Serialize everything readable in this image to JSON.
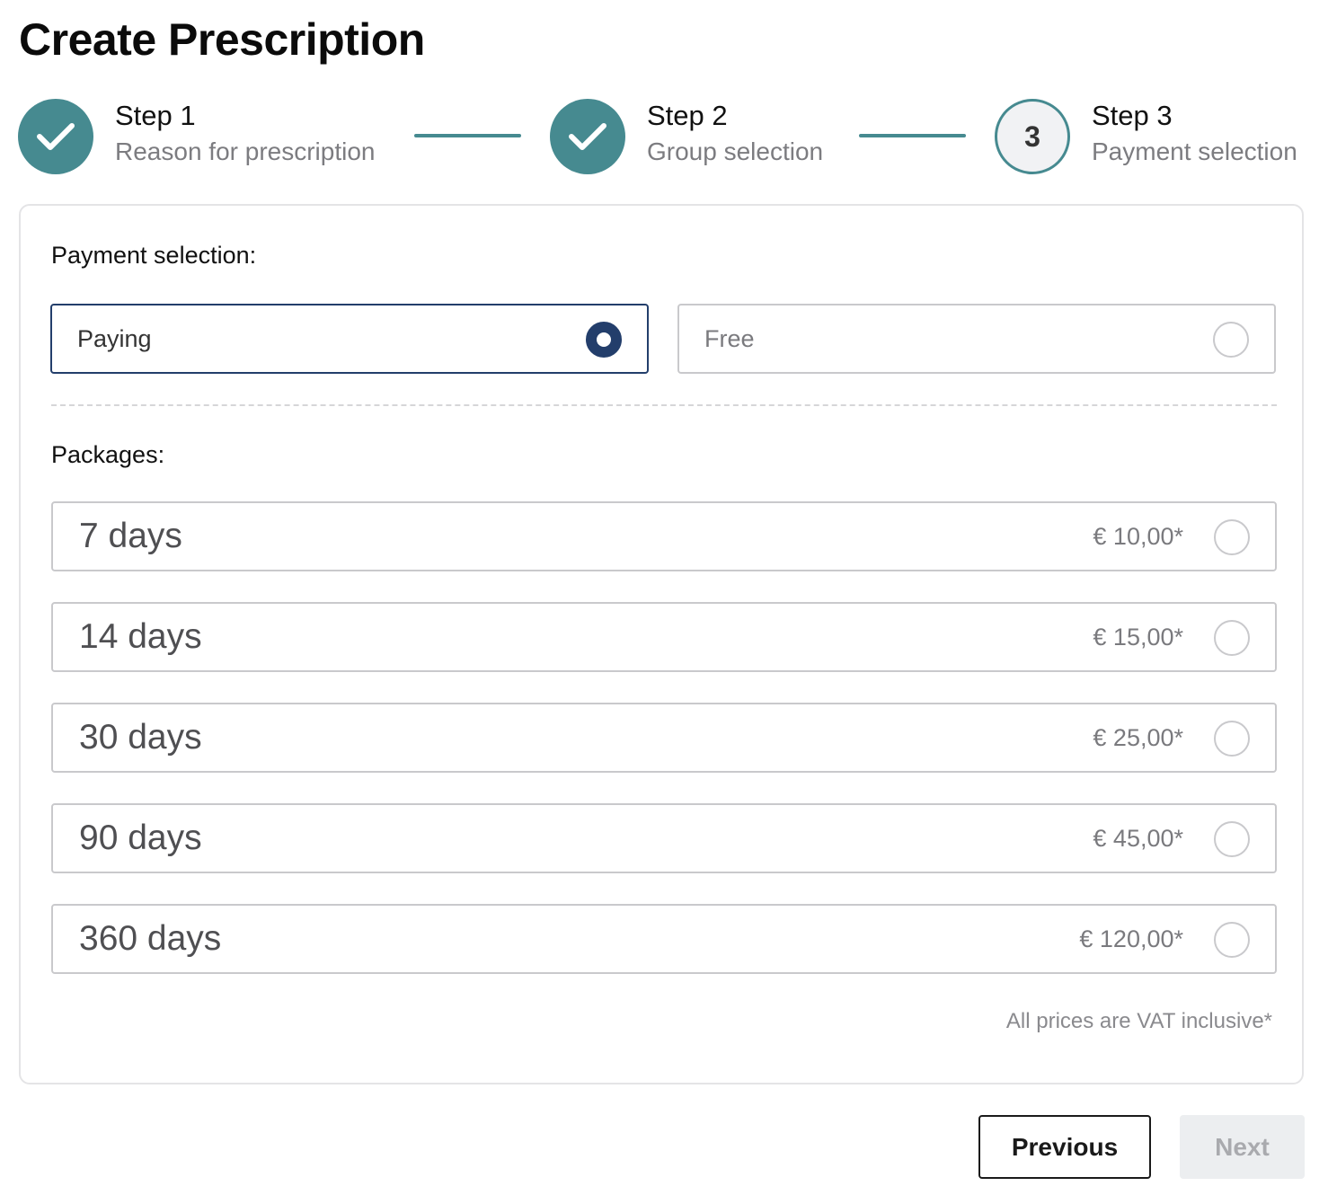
{
  "page": {
    "title": "Create Prescription"
  },
  "stepper": {
    "steps": [
      {
        "title": "Step 1",
        "subtitle": "Reason for prescription",
        "status": "completed",
        "icon": "check-icon"
      },
      {
        "title": "Step 2",
        "subtitle": "Group selection",
        "status": "completed",
        "icon": "check-icon"
      },
      {
        "title": "Step 3",
        "subtitle": "Payment selection",
        "status": "current",
        "number": "3"
      }
    ]
  },
  "payment": {
    "label": "Payment selection:",
    "options": [
      {
        "label": "Paying",
        "selected": true
      },
      {
        "label": "Free",
        "selected": false
      }
    ]
  },
  "packages": {
    "label": "Packages:",
    "items": [
      {
        "name": "7 days",
        "price": "€ 10,00*",
        "selected": false
      },
      {
        "name": "14 days",
        "price": "€ 15,00*",
        "selected": false
      },
      {
        "name": "30 days",
        "price": "€ 25,00*",
        "selected": false
      },
      {
        "name": "90 days",
        "price": "€ 45,00*",
        "selected": false
      },
      {
        "name": "360 days",
        "price": "€ 120,00*",
        "selected": false
      }
    ],
    "note": "All prices are VAT inclusive*"
  },
  "actions": {
    "previous_label": "Previous",
    "next_label": "Next",
    "next_disabled": true
  },
  "colors": {
    "accent": "#468a90",
    "selected": "#233e6b",
    "border": "#c9c9cc",
    "disabled_bg": "#eceef0"
  }
}
